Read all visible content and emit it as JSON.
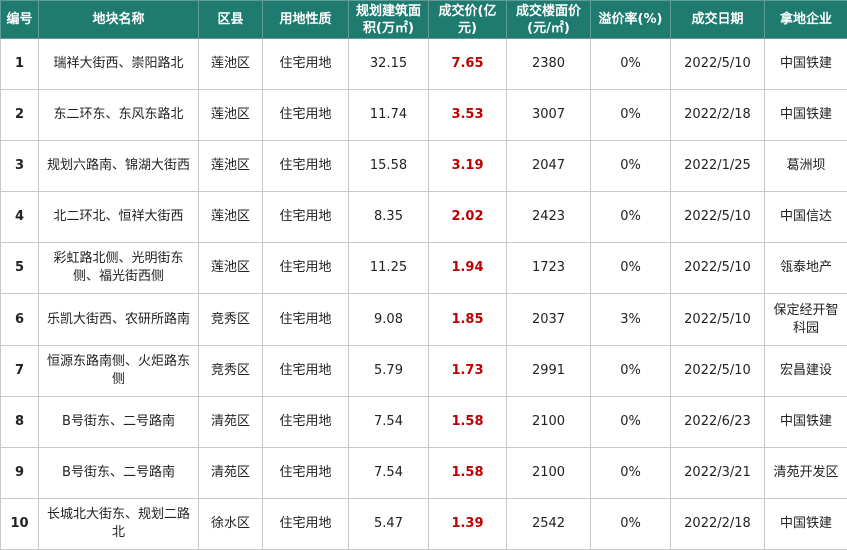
{
  "headers": [
    "编号",
    "地块名称",
    "区县",
    "用地性质",
    "规划建筑面积(万㎡)",
    "成交价(亿元)",
    "成交楼面价(元/㎡)",
    "溢价率(%)",
    "成交日期",
    "拿地企业"
  ],
  "rows": [
    {
      "no": "1",
      "name": "瑞祥大街西、崇阳路北",
      "district": "莲池区",
      "use": "住宅用地",
      "area": "32.15",
      "price": "7.65",
      "floor_price": "2380",
      "premium": "0%",
      "date": "2022/5/10",
      "company": "中国铁建"
    },
    {
      "no": "2",
      "name": "东二环东、东风东路北",
      "district": "莲池区",
      "use": "住宅用地",
      "area": "11.74",
      "price": "3.53",
      "floor_price": "3007",
      "premium": "0%",
      "date": "2022/2/18",
      "company": "中国铁建"
    },
    {
      "no": "3",
      "name": "规划六路南、锦湖大街西",
      "district": "莲池区",
      "use": "住宅用地",
      "area": "15.58",
      "price": "3.19",
      "floor_price": "2047",
      "premium": "0%",
      "date": "2022/1/25",
      "company": "葛洲坝"
    },
    {
      "no": "4",
      "name": "北二环北、恒祥大街西",
      "district": "莲池区",
      "use": "住宅用地",
      "area": "8.35",
      "price": "2.02",
      "floor_price": "2423",
      "premium": "0%",
      "date": "2022/5/10",
      "company": "中国信达"
    },
    {
      "no": "5",
      "name": "彩虹路北侧、光明街东侧、福光街西侧",
      "district": "莲池区",
      "use": "住宅用地",
      "area": "11.25",
      "price": "1.94",
      "floor_price": "1723",
      "premium": "0%",
      "date": "2022/5/10",
      "company": "瓴泰地产"
    },
    {
      "no": "6",
      "name": "乐凯大街西、农研所路南",
      "district": "竞秀区",
      "use": "住宅用地",
      "area": "9.08",
      "price": "1.85",
      "floor_price": "2037",
      "premium": "3%",
      "date": "2022/5/10",
      "company": "保定经开智科园"
    },
    {
      "no": "7",
      "name": "恒源东路南侧、火炬路东侧",
      "district": "竞秀区",
      "use": "住宅用地",
      "area": "5.79",
      "price": "1.73",
      "floor_price": "2991",
      "premium": "0%",
      "date": "2022/5/10",
      "company": "宏昌建设"
    },
    {
      "no": "8",
      "name": "B号街东、二号路南",
      "district": "清苑区",
      "use": "住宅用地",
      "area": "7.54",
      "price": "1.58",
      "floor_price": "2100",
      "premium": "0%",
      "date": "2022/6/23",
      "company": "中国铁建"
    },
    {
      "no": "9",
      "name": "B号街东、二号路南",
      "district": "清苑区",
      "use": "住宅用地",
      "area": "7.54",
      "price": "1.58",
      "floor_price": "2100",
      "premium": "0%",
      "date": "2022/3/21",
      "company": "清苑开发区"
    },
    {
      "no": "10",
      "name": "长城北大街东、规划二路北",
      "district": "徐水区",
      "use": "住宅用地",
      "area": "5.47",
      "price": "1.39",
      "floor_price": "2542",
      "premium": "0%",
      "date": "2022/2/18",
      "company": "中国铁建"
    }
  ]
}
